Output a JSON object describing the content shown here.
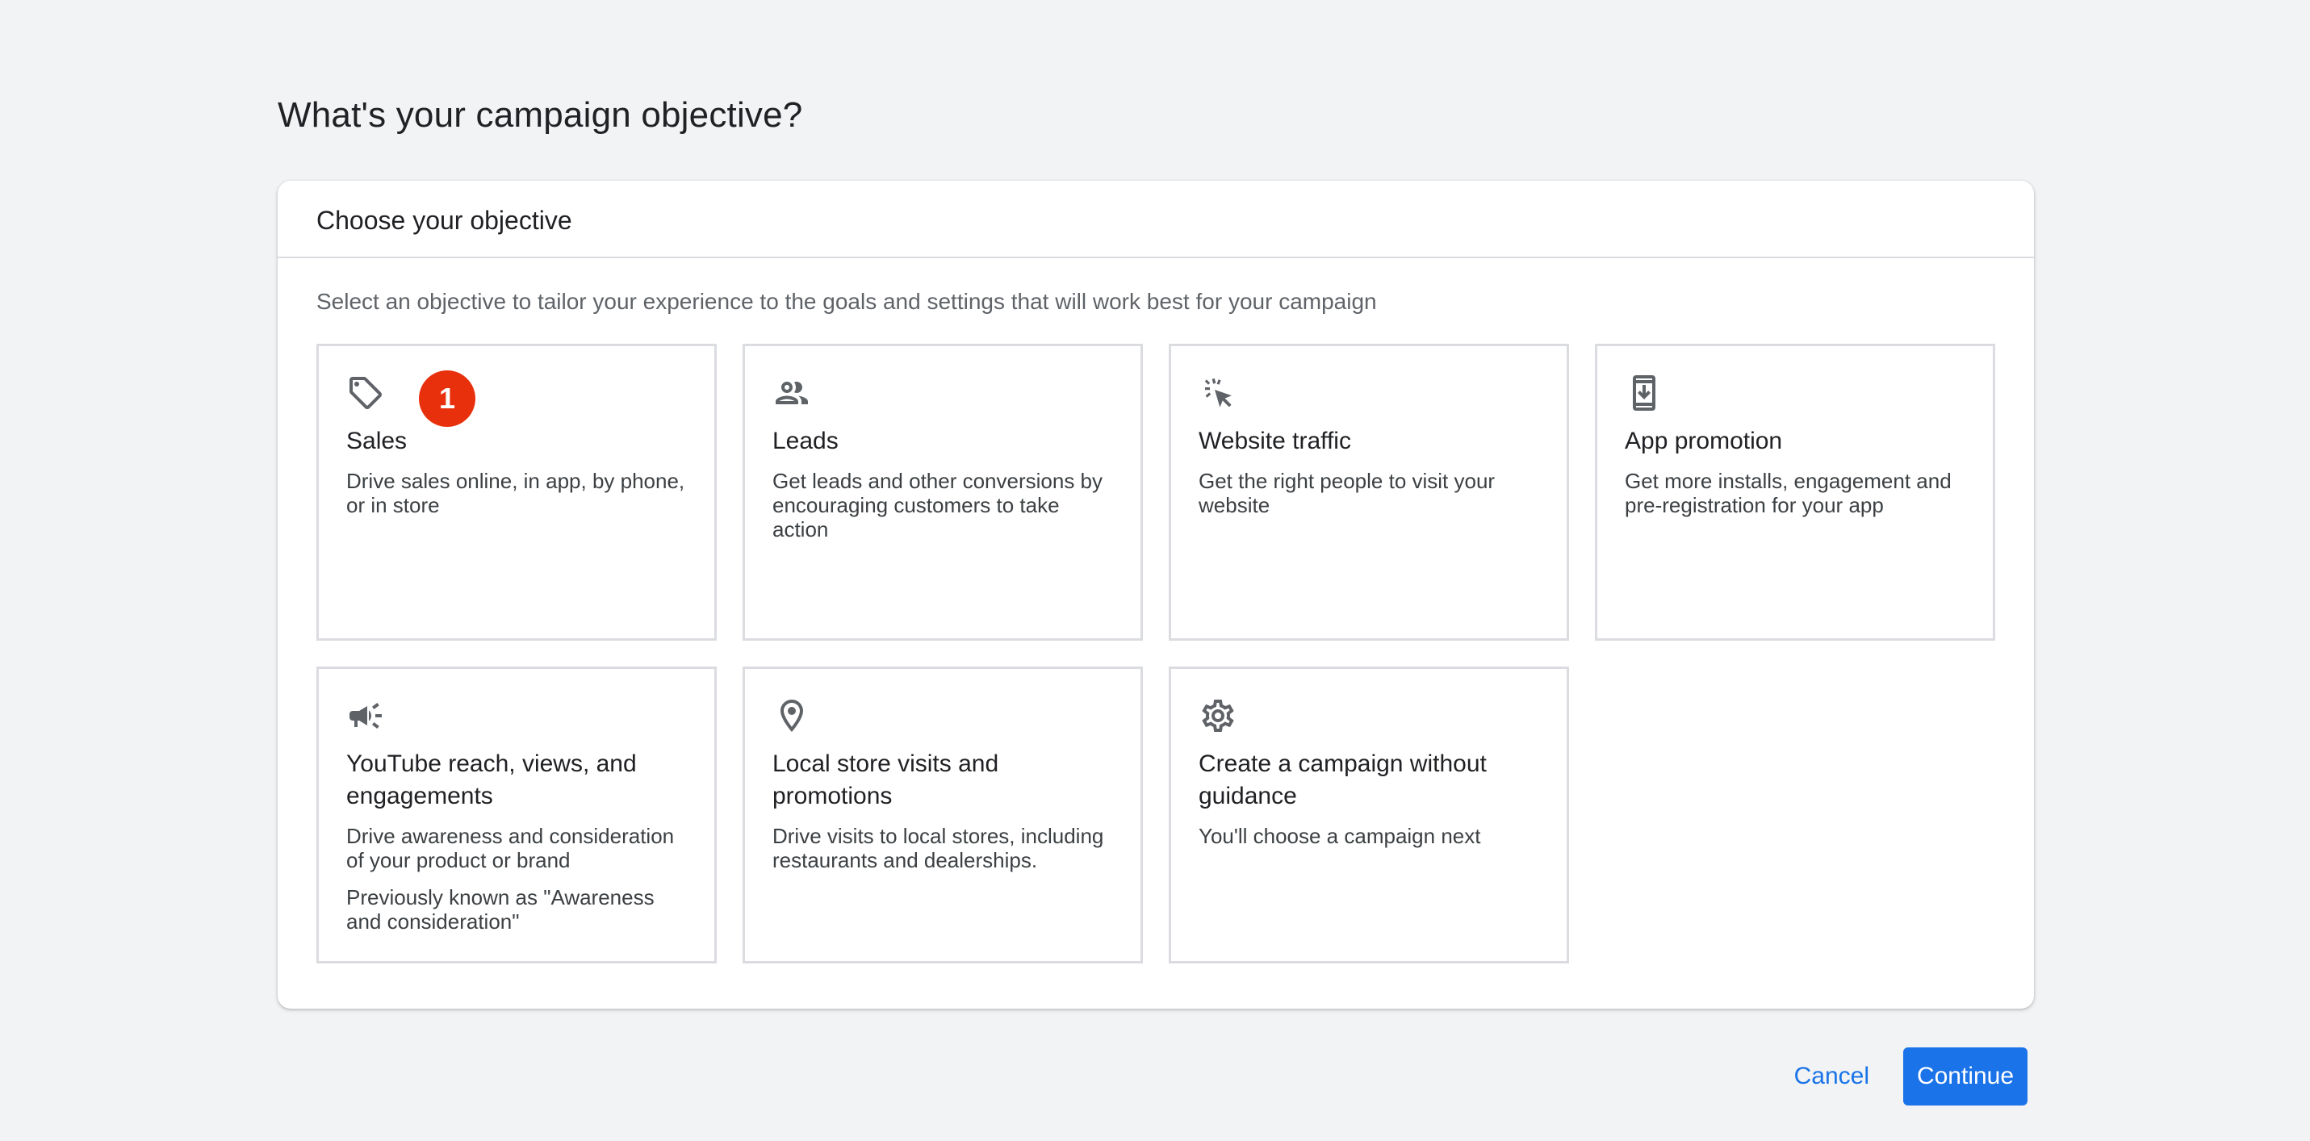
{
  "page": {
    "title": "What's your campaign objective?"
  },
  "panel": {
    "title": "Choose your objective",
    "subtitle": "Select an objective to tailor your experience to the goals and settings that will work best for your campaign"
  },
  "cards": [
    {
      "icon": "tag-icon",
      "title": "Sales",
      "desc": "Drive sales online, in app, by phone, or in store",
      "badge": "1"
    },
    {
      "icon": "people-icon",
      "title": "Leads",
      "desc": "Get leads and other conversions by encouraging customers to take action"
    },
    {
      "icon": "cursor-click-icon",
      "title": "Website traffic",
      "desc": "Get the right people to visit your website"
    },
    {
      "icon": "phone-download-icon",
      "title": "App promotion",
      "desc": "Get more installs, engagement and pre-registration for your app"
    },
    {
      "icon": "megaphone-icon",
      "title": "YouTube reach, views, and engagements",
      "desc": "Drive awareness and consideration of your product or brand",
      "note": "Previously known as \"Awareness and consideration\""
    },
    {
      "icon": "location-pin-icon",
      "title": "Local store visits and promotions",
      "desc": "Drive visits to local stores, including restaurants and dealerships."
    },
    {
      "icon": "gear-icon",
      "title": "Create a campaign without guidance",
      "desc": "You'll choose a campaign next"
    }
  ],
  "footer": {
    "cancel_label": "Cancel",
    "continue_label": "Continue"
  },
  "colors": {
    "accent": "#1a73e8",
    "badge": "#e8310c",
    "background": "#f1f3f4",
    "border": "#dadce0"
  }
}
